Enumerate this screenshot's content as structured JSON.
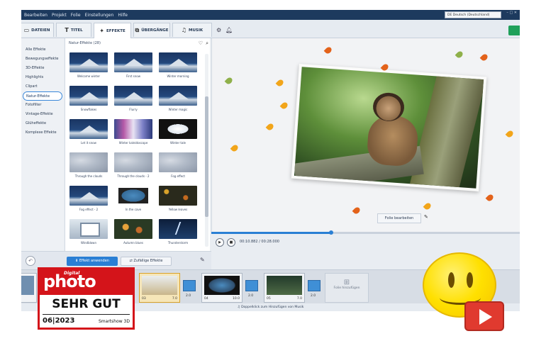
{
  "menu": [
    "Bearbeiten",
    "Projekt",
    "Folie",
    "Einstellungen",
    "Hilfe"
  ],
  "language": "DE Deutsch (Deutschland)",
  "tabs": {
    "dateien": "DATEIEN",
    "titel": "TITEL",
    "effekte": "EFFEKTE",
    "uebergaenge": "ÜBERGÄNGE",
    "musik": "MUSIK"
  },
  "categories": [
    "Alle Effekte",
    "Bewegungseffekte",
    "3D-Effekte",
    "Highlights",
    "Clipart",
    "Natur-Effekte",
    "Fotofilter",
    "Vintage-Effekte",
    "Glüheffekte",
    "Komplexe Effekte"
  ],
  "panel_title": "Natur-Effekte (28)",
  "effects": [
    "Welcome winter",
    "First snow",
    "Winter morning",
    "Snowflakes",
    "Flurry",
    "Winter magic",
    "Let it snow",
    "Winter kaleidoscope",
    "Winter tale",
    "Through the clouds",
    "Through the clouds - 2",
    "Fog effect",
    "Fog effect - 2",
    "In the cave",
    "Yellow leaves",
    "Windblown",
    "Autumn blues",
    "Thunderstorm"
  ],
  "actions": {
    "apply": "Effekt anwenden",
    "random": "Zufällige Effekte"
  },
  "preview": {
    "edit_slide": "Folie bearbeiten"
  },
  "playback": {
    "timecode": "00:10.882 / 00:28.000",
    "progress": 0.389
  },
  "timeline": {
    "clips": [
      {
        "num": "03",
        "dur": "7.0"
      },
      {
        "num": "04",
        "dur": "10.0"
      },
      {
        "num": "05",
        "dur": "7.0"
      }
    ],
    "transitions": [
      "2.0",
      "2.0",
      "2.0"
    ],
    "add_slide": "Folie hinzufügen",
    "music_hint": "Doppelklick zum Hinzufügen von Musik"
  },
  "badge": {
    "brand_small": "Digital",
    "brand": "photo",
    "rating": "SEHR GUT",
    "issue": "06|2023",
    "product": "Smartshow 3D"
  },
  "colors": {
    "accent": "#2a7fd4",
    "menubar": "#1d3a5e",
    "badge_red": "#d4141a"
  }
}
